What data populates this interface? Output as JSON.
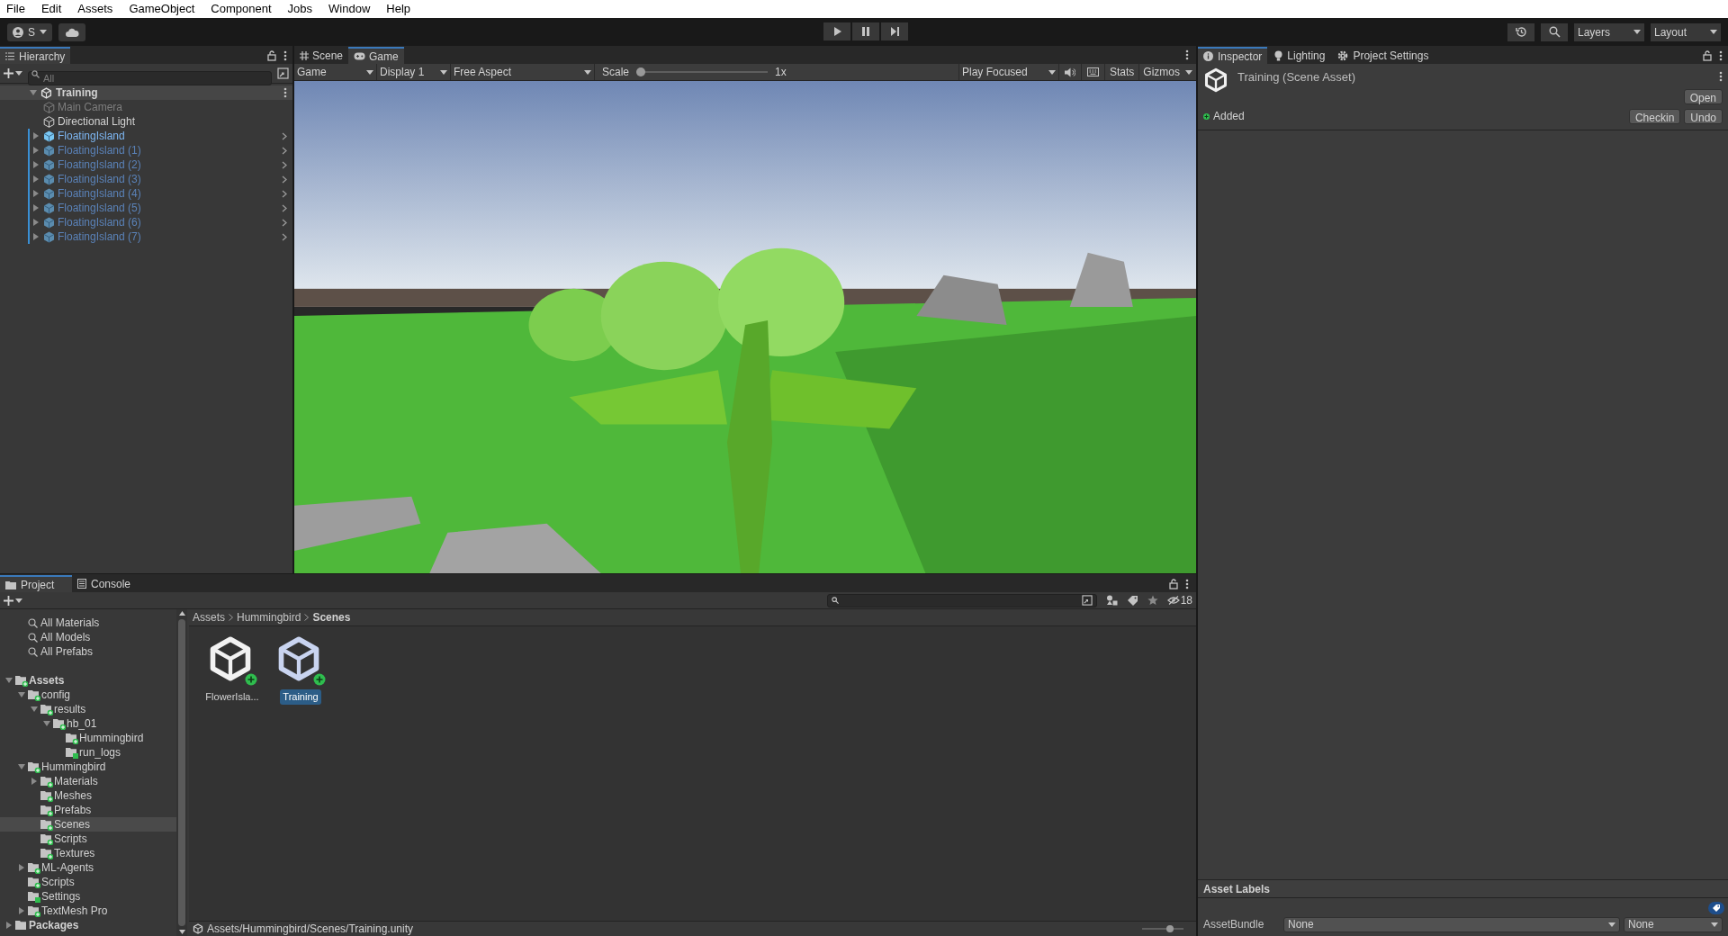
{
  "menu_bar": [
    "File",
    "Edit",
    "Assets",
    "GameObject",
    "Component",
    "Jobs",
    "Window",
    "Help"
  ],
  "toolbar": {
    "account": "S",
    "layers": "Layers",
    "layout": "Layout"
  },
  "hierarchy": {
    "title": "Hierarchy",
    "placeholder": "All",
    "scene": {
      "name": "Training",
      "expanded": true,
      "children": [
        {
          "name": "Main Camera",
          "kind": "object",
          "disabled": true,
          "selected": false
        },
        {
          "name": "Directional Light",
          "kind": "object",
          "disabled": false,
          "selected": false
        },
        {
          "name": "FloatingIsland",
          "kind": "prefab",
          "disabled": false,
          "expanded": false,
          "selected": false
        },
        {
          "name": "FloatingIsland (1)",
          "kind": "prefab",
          "disabled": true,
          "expanded": false,
          "selected": false
        },
        {
          "name": "FloatingIsland (2)",
          "kind": "prefab",
          "disabled": true,
          "expanded": false,
          "selected": false
        },
        {
          "name": "FloatingIsland (3)",
          "kind": "prefab",
          "disabled": true,
          "expanded": false,
          "selected": false
        },
        {
          "name": "FloatingIsland (4)",
          "kind": "prefab",
          "disabled": true,
          "expanded": false,
          "selected": false
        },
        {
          "name": "FloatingIsland (5)",
          "kind": "prefab",
          "disabled": true,
          "expanded": false,
          "selected": false
        },
        {
          "name": "FloatingIsland (6)",
          "kind": "prefab",
          "disabled": true,
          "expanded": false,
          "selected": false
        },
        {
          "name": "FloatingIsland (7)",
          "kind": "prefab",
          "disabled": true,
          "expanded": false,
          "selected": false
        }
      ]
    }
  },
  "view_tabs": [
    {
      "label": "Scene",
      "kind": "scene",
      "selected": false
    },
    {
      "label": "Game",
      "kind": "game",
      "selected": true
    }
  ],
  "game_toolbar": {
    "target": "Game",
    "display": "Display 1",
    "aspect": "Free Aspect",
    "scale_label": "Scale",
    "level": 0,
    "scale_value": "1x",
    "play_mode": "Play Focused",
    "stats": "Stats",
    "gizmos": "Gizmos"
  },
  "inspector_tabs": [
    {
      "label": "Inspector",
      "kind": "info",
      "selected": true
    },
    {
      "label": "Lighting",
      "kind": "bulb",
      "selected": false
    },
    {
      "label": "Project Settings",
      "kind": "gear",
      "selected": false
    }
  ],
  "inspector": {
    "asset_title": "Training (Scene Asset)",
    "open_button": "Open",
    "vcs_status": "Added",
    "vcs_buttons": [
      "Checkin",
      "Undo"
    ],
    "asset_labels_title": "Asset Labels",
    "asset_bundle_label": "AssetBundle",
    "asset_bundle": "None",
    "asset_bundle_variant": "None"
  },
  "bottom_tabs": [
    {
      "label": "Project",
      "kind": "folder",
      "selected": true
    },
    {
      "label": "Console",
      "kind": "console",
      "selected": false
    }
  ],
  "project": {
    "hidden_count": "18",
    "favorites": [
      "All Materials",
      "All Models",
      "All Prefabs"
    ],
    "tree": [
      {
        "name": "Assets",
        "kind": "added",
        "expanded": true,
        "selected": false,
        "children": [
          {
            "name": "config",
            "kind": "added",
            "expanded": true,
            "selected": false,
            "children": [
              {
                "name": "results",
                "kind": "added",
                "expanded": true,
                "selected": false,
                "children": [
                  {
                    "name": "hb_01",
                    "kind": "added",
                    "expanded": true,
                    "selected": false,
                    "children": [
                      {
                        "name": "Hummingbird",
                        "kind": "added",
                        "selected": false
                      },
                      {
                        "name": "run_logs",
                        "kind": "modified",
                        "selected": false
                      }
                    ]
                  }
                ]
              }
            ]
          },
          {
            "name": "Hummingbird",
            "kind": "added",
            "expanded": true,
            "selected": false,
            "children": [
              {
                "name": "Materials",
                "kind": "added",
                "expanded": false,
                "selected": false
              },
              {
                "name": "Meshes",
                "kind": "added",
                "selected": false
              },
              {
                "name": "Prefabs",
                "kind": "added",
                "selected": false
              },
              {
                "name": "Scenes",
                "kind": "added",
                "selected": true
              },
              {
                "name": "Scripts",
                "kind": "added",
                "selected": false
              },
              {
                "name": "Textures",
                "kind": "added",
                "selected": false
              }
            ]
          },
          {
            "name": "ML-Agents",
            "kind": "added",
            "expanded": false,
            "selected": false
          },
          {
            "name": "Scripts",
            "kind": "added",
            "selected": false
          },
          {
            "name": "Settings",
            "kind": "modified",
            "selected": false
          },
          {
            "name": "TextMesh Pro",
            "kind": "added",
            "expanded": false,
            "selected": false
          }
        ]
      },
      {
        "name": "Packages",
        "kind": "plain",
        "expanded": false,
        "selected": false
      }
    ],
    "breadcrumb": [
      "Assets",
      "Hummingbird",
      "Scenes"
    ],
    "assets": [
      {
        "name": "FlowerIsla...",
        "selected": false
      },
      {
        "name": "Training",
        "selected": true
      }
    ],
    "path": "Assets/Hummingbird/Scenes/Training.unity",
    "thumbnail_size": {
      "level": 0.7
    }
  }
}
